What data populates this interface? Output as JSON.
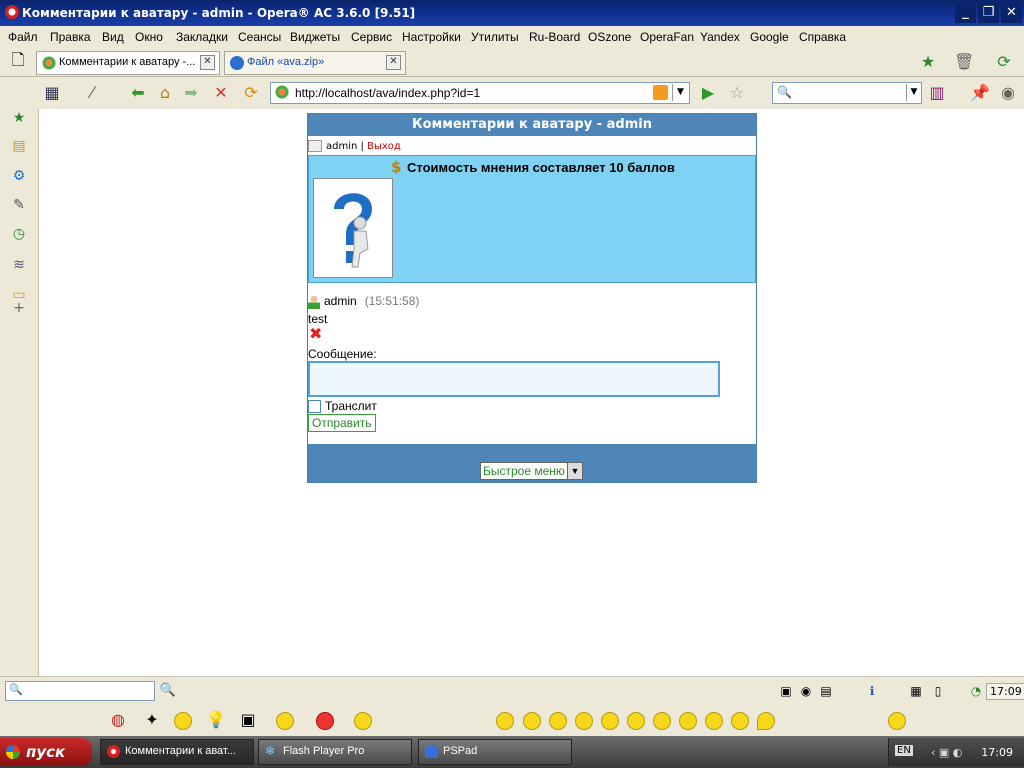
{
  "window": {
    "title": "Комментарии к аватару - admin - Opera® AC 3.6.0 [9.51]"
  },
  "menu": {
    "items": [
      "Файл",
      "Правка",
      "Вид",
      "Окно",
      "Закладки",
      "Сеансы",
      "Виджеты",
      "Сервис",
      "Настройки",
      "Утилиты",
      "Ru-Board",
      "OSzone",
      "OperaFan",
      "Yandex",
      "Google",
      "Справка"
    ]
  },
  "tabs": [
    {
      "label": "Комментарии к аватару -...",
      "active": true
    },
    {
      "label": "Файл «ava.zip»",
      "active": false
    }
  ],
  "address": {
    "url": "http://localhost/ava/index.php?id=1"
  },
  "page": {
    "header": "Комментарии к аватару - admin",
    "user": "admin",
    "separator": "|",
    "logout": "Выход",
    "cost_text": "Стоимость мнения составляет 10 баллов",
    "comment": {
      "author": "admin",
      "time": "(15:51:58)",
      "text": "test"
    },
    "message_label": "Сообщение:",
    "translit_label": "Транслит",
    "send_label": "Отправить",
    "quick_menu": "Быстрое меню"
  },
  "status": {
    "clock": "17:09"
  },
  "taskbar": {
    "start": "пуск",
    "items": [
      "Комментарии к ават...",
      "Flash Player Pro",
      "PSPad"
    ],
    "lang": "EN",
    "clock": "17:09"
  },
  "colors": {
    "title_bar": "#0a246a",
    "page_header": "#4f86b9",
    "info_box": "#7fd2f3",
    "logout": "#cc0000",
    "send": "#2a8a2a"
  }
}
